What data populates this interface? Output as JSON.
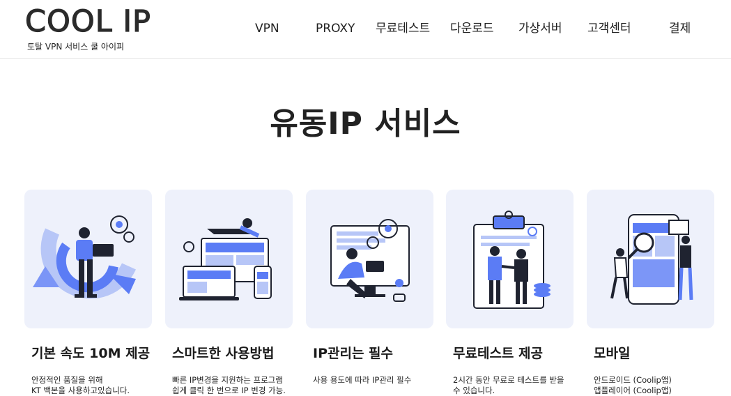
{
  "header": {
    "logo_text": "COOL IP",
    "logo_subtitle": "토탈 VPN 서비스 쿨 아이피",
    "nav": [
      "VPN",
      "PROXY",
      "무료테스트",
      "다운로드",
      "가상서버",
      "고객센터",
      "결제"
    ]
  },
  "main": {
    "title": "유동IP 서비스",
    "cards": [
      {
        "title": "기본 속도 10M 제공",
        "desc": [
          "안정적인 품질을 위해",
          "KT 백본을 사용하고있습니다."
        ]
      },
      {
        "title": "스마트한 사용방법",
        "desc": [
          "빠른 IP변경을 지원하는 프로그램",
          "쉽게 클릭 한 번으로 IP 변경 가능."
        ]
      },
      {
        "title": "IP관리는 필수",
        "desc": [
          "사용 용도에 따라 IP관리 필수"
        ]
      },
      {
        "title": "무료테스트 제공",
        "desc": [
          "2시간 동안 무료로 테스트를 받을",
          "수 있습니다."
        ]
      },
      {
        "title": "모바일",
        "desc": [
          "안드로이드 (Coolip앱)",
          "앱플레이어 (Coolip앱)"
        ]
      }
    ]
  },
  "colors": {
    "accent": "#5b7cf5",
    "accent_light": "#b7c6f7",
    "card_bg": "#eef1fb",
    "dark": "#1f2330"
  }
}
